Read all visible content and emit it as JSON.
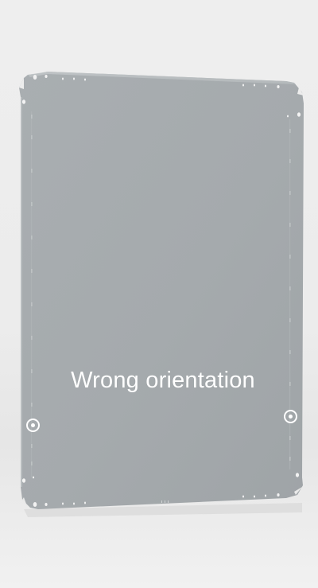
{
  "caption": {
    "text": "Wrong orientation"
  },
  "colors": {
    "background": "#ededed",
    "panel": "#a8adb0",
    "panel_edge": "#bfc4c6",
    "caption": "#ffffff",
    "markers": "#ffffff"
  },
  "scene": {
    "object": "mounting-plate",
    "markers": [
      {
        "name": "left-marker-icon"
      },
      {
        "name": "right-marker-icon"
      }
    ]
  }
}
